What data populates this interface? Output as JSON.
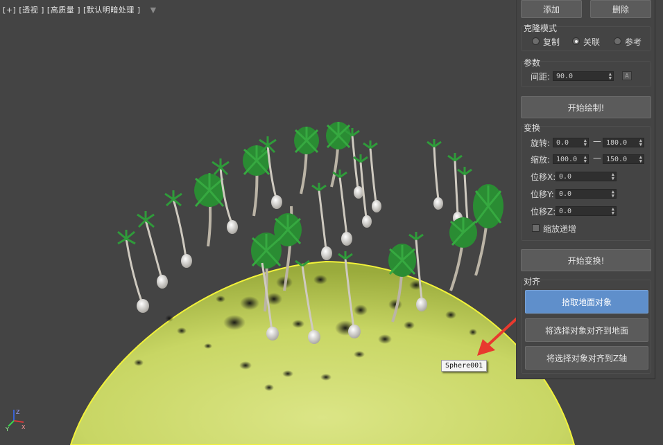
{
  "viewport": {
    "label_parts": [
      "[+]",
      "[透视 ]",
      "[高质量 ]",
      "[默认明暗处理 ]"
    ],
    "tooltip": "Sphere001",
    "axis_labels": [
      "Z",
      "X",
      "Y"
    ]
  },
  "panel": {
    "add_button": "添加",
    "delete_button": "删除",
    "clone_mode": {
      "title": "克隆模式",
      "options": [
        "复制",
        "关联",
        "参考"
      ],
      "selected": "关联"
    },
    "params": {
      "title": "参数",
      "spacing_label": "间距:",
      "spacing_value": "90.0"
    },
    "start_paint_button": "开始绘制!",
    "transform": {
      "title": "变换",
      "rotate_label": "旋转:",
      "rotate_min": "0.0",
      "rotate_max": "180.0",
      "scale_label": "缩放:",
      "scale_min": "100.0",
      "scale_max": "150.0",
      "offset_x_label": "位移X:",
      "offset_x_value": "0.0",
      "offset_y_label": "位移Y:",
      "offset_y_value": "0.0",
      "offset_z_label": "位移Z:",
      "offset_z_value": "0.0",
      "scale_increment_label": "缩放递增",
      "dash": "—"
    },
    "start_transform_button": "开始变换!",
    "align": {
      "title": "对齐",
      "pick_ground_button": "拾取地面对象",
      "align_to_ground_button": "将选择对象对齐到地面",
      "align_to_z_button": "将选择对象对齐到Z轴"
    }
  },
  "colors": {
    "viewport_bg": "#444444",
    "sphere": "#cfdb6e",
    "sphere_outline": "#f2f23a",
    "accent_button": "#5f8fcb",
    "arrow": "#e8392e"
  }
}
